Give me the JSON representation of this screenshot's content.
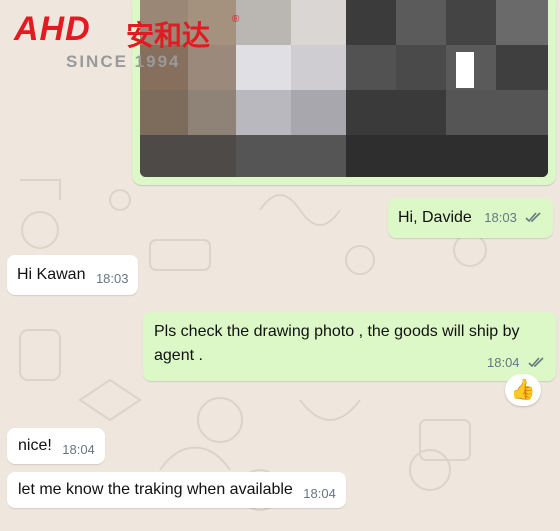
{
  "logo": {
    "brand": "AHD",
    "brand_cn": "安和达",
    "registered": "®",
    "since": "SINCE 1994"
  },
  "messages": [
    {
      "direction": "out",
      "text": "Hi, Davide",
      "time": "18:03",
      "status": "read"
    },
    {
      "direction": "in",
      "text": "Hi Kawan",
      "time": "18:03"
    },
    {
      "direction": "out",
      "text": "Pls check the drawing photo , the goods will ship by agent .",
      "time": "18:04",
      "status": "read",
      "reaction": "👍"
    },
    {
      "direction": "in",
      "text": "nice!",
      "time": "18:04"
    },
    {
      "direction": "in",
      "text": "let me know the traking when available",
      "time": "18:04"
    }
  ],
  "colors": {
    "outgoing": "#dcf8c6",
    "incoming": "#ffffff",
    "background": "#efe7de",
    "brand_red": "#e01b22",
    "read_ticks": "#667781"
  }
}
